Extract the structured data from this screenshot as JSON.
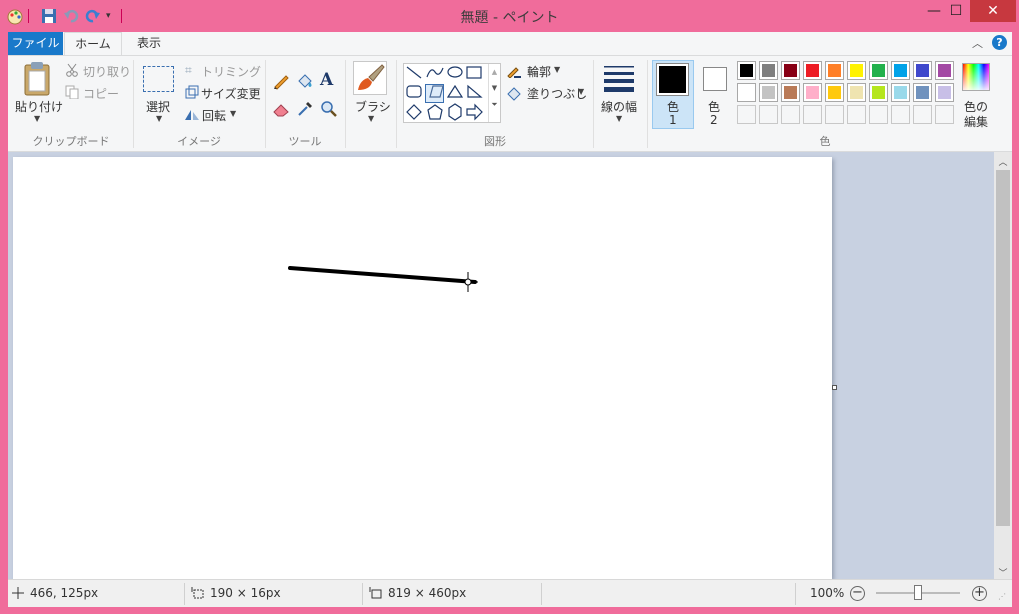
{
  "window": {
    "title": "無題 - ペイント",
    "close_glyph": "✕",
    "min_glyph": "—",
    "max_glyph": "☐"
  },
  "tabs": {
    "file": "ファイル",
    "home": "ホーム",
    "view": "表示"
  },
  "clipboard": {
    "paste": "貼り付け",
    "cut": "切り取り",
    "copy": "コピー",
    "group": "クリップボード"
  },
  "image": {
    "select": "選択",
    "crop": "トリミング",
    "resize": "サイズ変更",
    "rotate": "回転",
    "group": "イメージ"
  },
  "tools": {
    "group": "ツール",
    "text_glyph": "A"
  },
  "brush": {
    "label": "ブラシ"
  },
  "shapes": {
    "outline": "輪郭",
    "fill": "塗りつぶし",
    "group": "図形"
  },
  "size": {
    "label": "線の幅"
  },
  "colors": {
    "color1_label": "色",
    "color1_num": "1",
    "color2_label": "色",
    "color2_num": "2",
    "edit_label_1": "色の",
    "edit_label_2": "編集",
    "group": "色",
    "color1_value": "#000000",
    "color2_value": "#ffffff",
    "palette_row1": [
      "#000000",
      "#7f7f7f",
      "#880015",
      "#ed1c24",
      "#ff7f27",
      "#fff200",
      "#22b14c",
      "#00a2e8",
      "#3f48cc",
      "#a349a4"
    ],
    "palette_row2": [
      "#ffffff",
      "#c3c3c3",
      "#b97a57",
      "#ffaec9",
      "#ffc90e",
      "#efe4b0",
      "#b5e61d",
      "#99d9ea",
      "#7092be",
      "#c8bfe7"
    ]
  },
  "status": {
    "cursor_pos": "466, 125px",
    "selection_size": "190 × 16px",
    "image_size": "819 × 460px",
    "zoom": "100%"
  },
  "theme": {
    "accent": "#f06c9b",
    "file_tab": "#1979ca"
  }
}
